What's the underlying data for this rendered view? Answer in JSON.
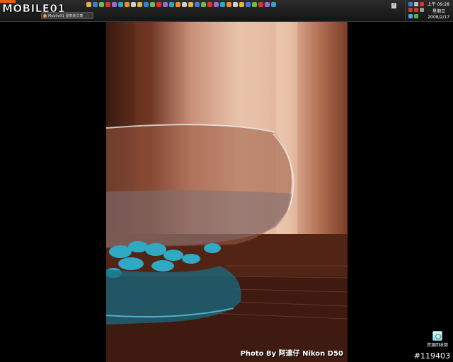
{
  "taskbar": {
    "brand": "MOBILE01",
    "task_button_label": "Mobile01 發表新文章",
    "help_label": "?",
    "quicklaunch_icons": [
      "folder-icon",
      "ie-icon",
      "media-icon",
      "app-icon",
      "mail-icon",
      "word-icon",
      "excel-icon",
      "pdf-icon",
      "app-icon",
      "photoshop-icon",
      "app-icon",
      "app-icon",
      "firefox-icon",
      "app-icon",
      "app-icon",
      "globe-icon",
      "app-icon",
      "app-icon",
      "app-icon",
      "msn-icon",
      "app-icon",
      "app-icon",
      "app-icon",
      "app-icon",
      "skype-icon",
      "app-icon",
      "app-icon",
      "app-icon",
      "info-icon",
      "app-icon"
    ]
  },
  "tray": {
    "time": "上午 09:28",
    "day": "星期日",
    "date": "2008/2/17"
  },
  "wallpaper": {
    "caption": "Photo By 阿達仔 Nikon D50"
  },
  "desktop": {
    "recycle_bin_label": "資源回收筒"
  },
  "footer": {
    "id": "#119403"
  },
  "colors": {
    "taskbar": "#1e1e1e",
    "water": "#2fa9c4",
    "background": "#000000"
  }
}
